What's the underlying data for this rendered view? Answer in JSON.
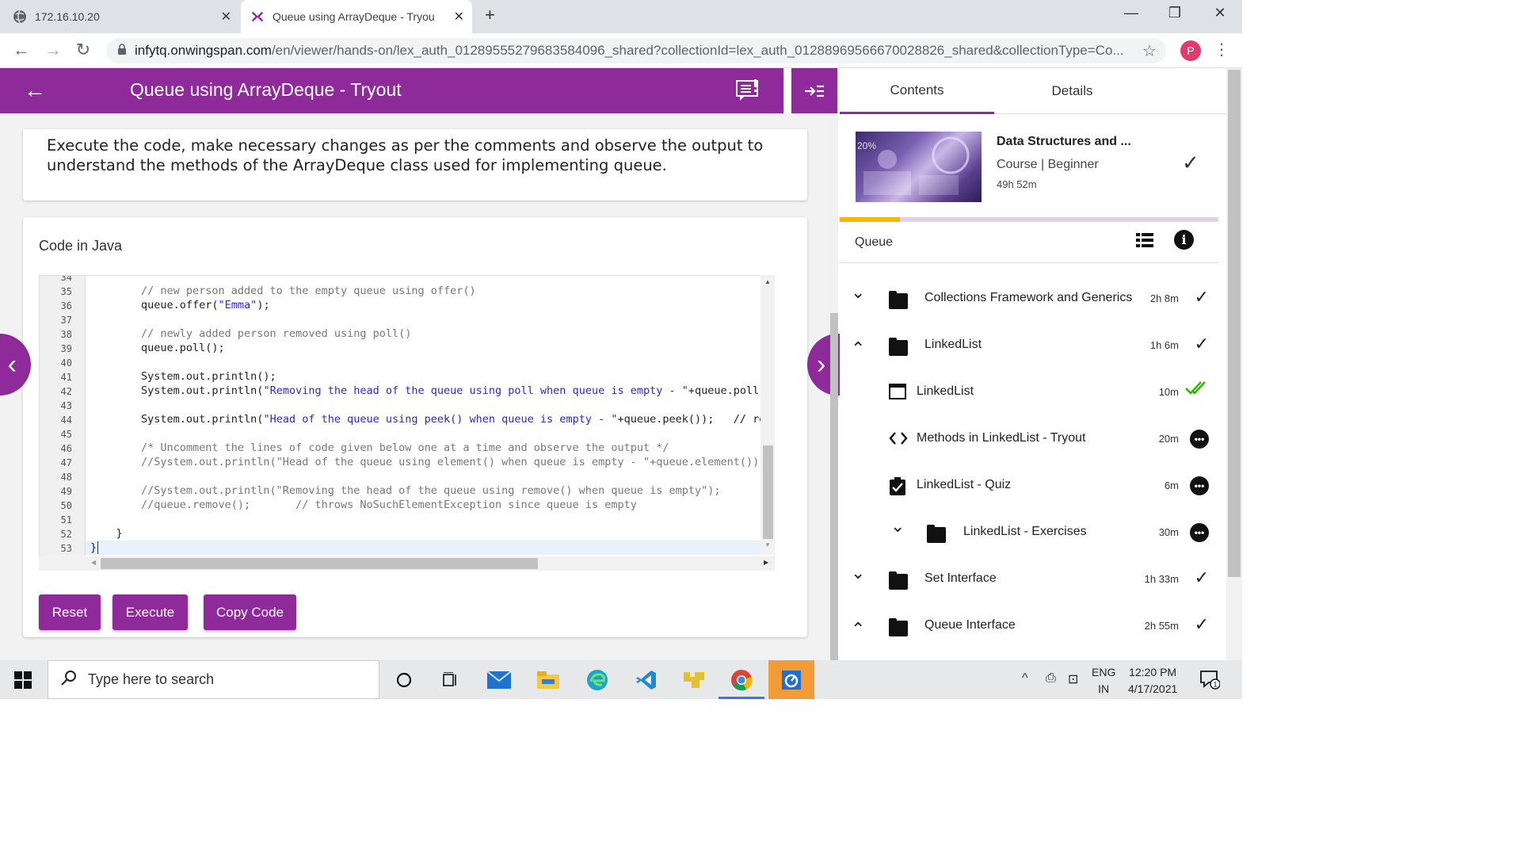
{
  "browser": {
    "tabs": [
      {
        "title": "172.16.10.20",
        "active": false
      },
      {
        "title": "Queue using ArrayDeque - Tryou",
        "active": true
      }
    ],
    "url_domain": "infytq.onwingspan.com",
    "url_rest": "/en/viewer/hands-on/lex_auth_01289555279683584096_shared?collectionId=lex_auth_01288969566670028826_shared&collectionType=Co...",
    "profile_initial": "P"
  },
  "header": {
    "title": "Queue using ArrayDeque - Tryout"
  },
  "instructions": "Execute the code, make necessary changes as per the comments and observe the output to understand the methods of the ArrayDeque class used for implementing queue.",
  "code": {
    "title": "Code in Java",
    "lines": [
      {
        "n": "34",
        "text": ""
      },
      {
        "n": "35",
        "text": "// new person added to the empty queue using offer()",
        "comment": true
      },
      {
        "n": "36",
        "pre": "queue.offer(",
        "str": "\"Emma\"",
        "post": ");"
      },
      {
        "n": "37",
        "text": ""
      },
      {
        "n": "38",
        "text": "// newly added person removed using poll()",
        "comment": true
      },
      {
        "n": "39",
        "text": "queue.poll();"
      },
      {
        "n": "40",
        "text": ""
      },
      {
        "n": "41",
        "text": "System.out.println();"
      },
      {
        "n": "42",
        "pre": "System.out.println(",
        "str": "\"Removing the head of the queue using poll when queue is empty - \"",
        "post": "+queue.poll())"
      },
      {
        "n": "43",
        "text": ""
      },
      {
        "n": "44",
        "pre": "System.out.println(",
        "str": "\"Head of the queue using peek() when queue is empty - \"",
        "post": "+queue.peek());   // retu"
      },
      {
        "n": "45",
        "text": ""
      },
      {
        "n": "46",
        "text": "/* Uncomment the lines of code given below one at a time and observe the output */",
        "comment": true
      },
      {
        "n": "47",
        "text": "//System.out.println(\"Head of the queue using element() when queue is empty - \"+queue.element());",
        "comment": true
      },
      {
        "n": "48",
        "text": ""
      },
      {
        "n": "49",
        "text": "//System.out.println(\"Removing the head of the queue using remove() when queue is empty\");",
        "comment": true
      },
      {
        "n": "50",
        "text": "//queue.remove();       // throws NoSuchElementException since queue is empty",
        "comment": true
      },
      {
        "n": "51",
        "text": ""
      },
      {
        "n": "52",
        "text": "    }",
        "indent": -1
      },
      {
        "n": "53",
        "text": "}",
        "indent": -2
      }
    ],
    "buttons": {
      "reset": "Reset",
      "execute": "Execute",
      "copy": "Copy Code"
    }
  },
  "sidebar": {
    "tabs": {
      "contents": "Contents",
      "details": "Details"
    },
    "course": {
      "title": "Data Structures and ...",
      "meta": "Course |  Beginner",
      "duration": "49h 52m",
      "progress_fraction": 0.16
    },
    "section_title": "Queue",
    "items": [
      {
        "label": "Collections Framework and Generics",
        "duration": "2h 8m",
        "type": "folder",
        "expanded": false,
        "status": "check"
      },
      {
        "label": "LinkedList",
        "duration": "1h 6m",
        "type": "folder",
        "expanded": true,
        "status": "check"
      },
      {
        "label": "LinkedList",
        "duration": "10m",
        "type": "page",
        "status": "double-check"
      },
      {
        "label": "Methods in LinkedList - Tryout",
        "duration": "20m",
        "type": "code",
        "status": "more"
      },
      {
        "label": "LinkedList - Quiz",
        "duration": "6m",
        "type": "quiz",
        "status": "more"
      },
      {
        "label": "LinkedList - Exercises",
        "duration": "30m",
        "type": "folder",
        "expanded": false,
        "status": "more"
      },
      {
        "label": "Set Interface",
        "duration": "1h 33m",
        "type": "folder",
        "expanded": false,
        "status": "check"
      },
      {
        "label": "Queue Interface",
        "duration": "2h 55m",
        "type": "folder",
        "expanded": true,
        "status": "check"
      }
    ]
  },
  "taskbar": {
    "search_placeholder": "Type here to search",
    "lang_top": "ENG",
    "lang_bottom": "IN",
    "time": "12:20 PM",
    "date": "4/17/2021",
    "notif_count": "1"
  },
  "colors": {
    "brand": "#8e2a9a",
    "progress": "#f5b800",
    "done_green": "#2db300"
  }
}
